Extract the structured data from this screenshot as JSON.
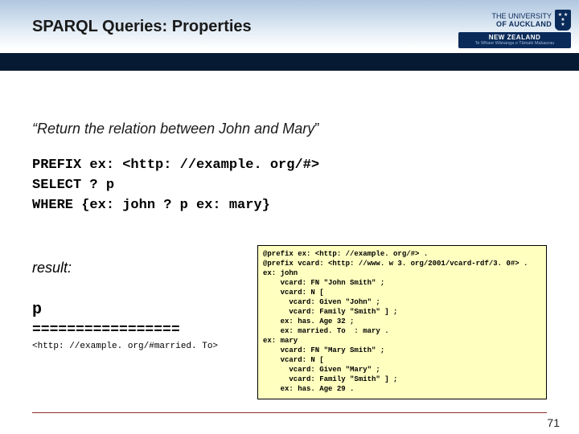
{
  "header": {
    "title": "SPARQL Queries: Properties",
    "uni_line1": "THE UNIVERSITY",
    "uni_line2": "OF AUCKLAND",
    "nz": "NEW ZEALAND",
    "maori": "Te Whare Wānanga o Tāmaki Makaurau"
  },
  "quote": {
    "open": "“",
    "text": "Return the relation between John and Mary",
    "close": "”"
  },
  "query": {
    "l1": "PREFIX ex: <http: //example. org/#>",
    "l2": "SELECT ? p",
    "l3": "WHERE {ex: john ? p ex: mary}"
  },
  "result": {
    "label": "result:",
    "col": "p",
    "rule": "=================",
    "row": "<http: //example. org/#married. To>"
  },
  "turtle": "@prefix ex: <http: //example. org/#> .\n@prefix vcard: <http: //www. w 3. org/2001/vcard-rdf/3. 0#> .\nex: john\n    vcard: FN \"John Smith\" ;\n    vcard: N [\n      vcard: Given \"John\" ;\n      vcard: Family \"Smith\" ] ;\n    ex: has. Age 32 ;\n    ex: married. To  : mary .\nex: mary\n    vcard: FN \"Mary Smith\" ;\n    vcard: N [\n      vcard: Given \"Mary\" ;\n      vcard: Family \"Smith\" ] ;\n    ex: has. Age 29 .",
  "page": "71"
}
